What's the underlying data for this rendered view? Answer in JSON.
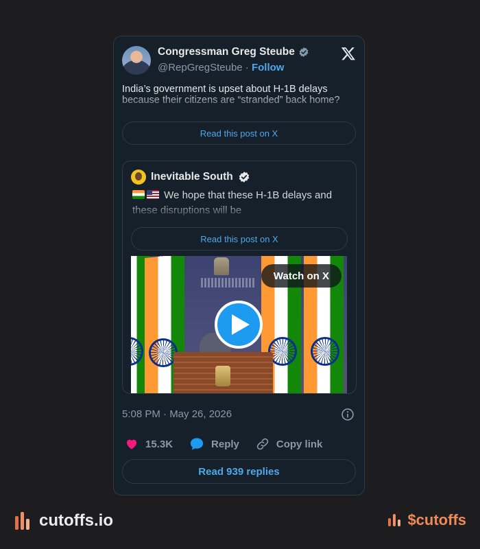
{
  "tweet": {
    "author_name": "Congressman Greg Steube",
    "handle": "@RepGregSteube",
    "separator": " · ",
    "follow_label": "Follow",
    "body": "India’s government is upset about H-1B delays because their citizens are “stranded” back home?",
    "read_post_label": "Read this post on X",
    "timestamp": "5:08 PM · May 26, 2026",
    "likes": "15.3K",
    "reply_label": "Reply",
    "copy_link_label": "Copy link",
    "read_replies_label": "Read 939 replies"
  },
  "quoted": {
    "author_name": "Inevitable South",
    "flags": [
      "india-flag",
      "usa-flag"
    ],
    "body": "We hope that these H-1B delays and these disruptions will be",
    "read_post_label": "Read this post on X",
    "watch_label": "Watch on X"
  },
  "footer": {
    "left_brand": "cutoffs.io",
    "right_ticker": "$cutoffs"
  },
  "colors": {
    "background": "#1d1d1f",
    "card": "#15202b",
    "link_blue": "#4fa8e8",
    "like_pink": "#f91880",
    "brand_orange": "#f08a56"
  }
}
